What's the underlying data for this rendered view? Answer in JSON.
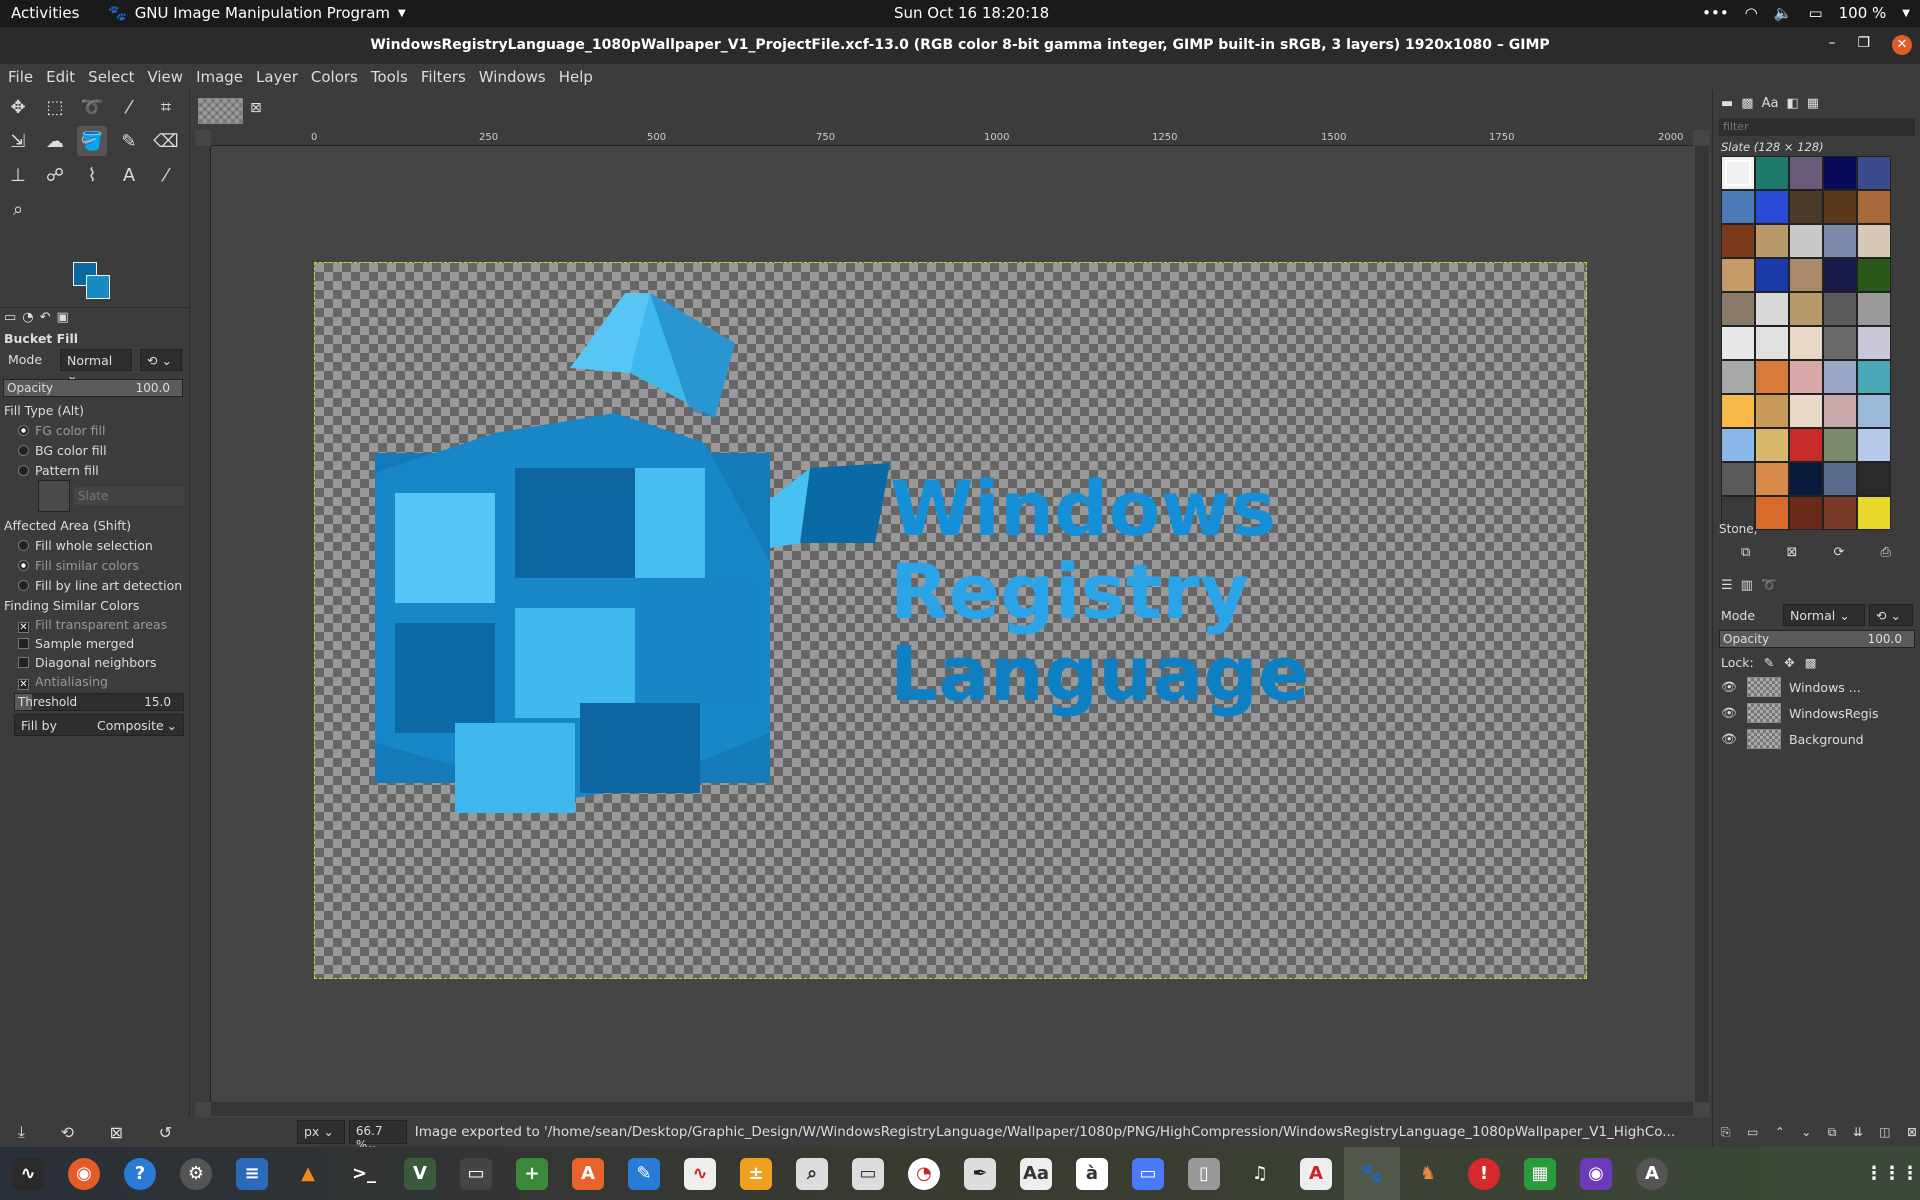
{
  "topbar": {
    "activities": "Activities",
    "app_name": "GNU Image Manipulation Program",
    "clock": "Sun Oct 16  18:20:18",
    "battery": "100 %"
  },
  "window": {
    "title": "WindowsRegistryLanguage_1080pWallpaper_V1_ProjectFile.xcf-13.0 (RGB color 8-bit gamma integer, GIMP built-in sRGB, 3 layers) 1920x1080 – GIMP"
  },
  "menu": [
    "File",
    "Edit",
    "Select",
    "View",
    "Image",
    "Layer",
    "Colors",
    "Tools",
    "Filters",
    "Windows",
    "Help"
  ],
  "tool_options": {
    "title": "Bucket Fill",
    "mode_label": "Mode",
    "mode_value": "Normal",
    "opacity_label": "Opacity",
    "opacity_value": "100.0",
    "fill_type_label": "Fill Type  (Alt)",
    "fill_types": [
      "FG color fill",
      "BG color fill",
      "Pattern fill"
    ],
    "pattern_name": "Slate",
    "affected_label": "Affected Area  (Shift)",
    "affected": [
      "Fill whole selection",
      "Fill similar colors",
      "Fill by line art detection"
    ],
    "finding_label": "Finding Similar Colors",
    "finding": [
      "Fill transparent areas",
      "Sample merged",
      "Diagonal neighbors",
      "Antialiasing"
    ],
    "threshold_label": "Threshold",
    "threshold_value": "15.0",
    "fillby_label": "Fill by",
    "fillby_value": "Composite"
  },
  "ruler": [
    "0",
    "250",
    "500",
    "750",
    "1000",
    "1250",
    "1500",
    "1750",
    "2000"
  ],
  "canvas_text": {
    "line1": "Windows",
    "line2": "Registry",
    "line3": "Language"
  },
  "status": {
    "unit": "px",
    "zoom": "66.7 %",
    "message": "Image exported to '/home/sean/Desktop/Graphic_Design/W/WindowsRegistryLanguage/Wallpaper/1080p/PNG/HighCompression/WindowsRegistryLanguage_1080pWallpaper_V1_HighCo..."
  },
  "patterns": {
    "filter_placeholder": "filter",
    "current": "Slate (128 × 128)",
    "selected_name": "Stone,",
    "colors": [
      "#f0f0f0",
      "#1e7a6a",
      "#6a5a7a",
      "#0a0a5a",
      "#3a4a8a",
      "#4a7ab8",
      "#2a4ad8",
      "#4a3a2a",
      "#5a3a1a",
      "#a86a3a",
      "#7a3a1a",
      "#b89a6a",
      "#c8c8c8",
      "#7a8aa8",
      "#d8c8b8",
      "#c89a6a",
      "#1a3aa8",
      "#a88a6a",
      "#1a1a4a",
      "#2a5a1a",
      "#8a7a6a",
      "#d8d8d8",
      "#b89a6a",
      "#5a5a5a",
      "#9a9a9a",
      "#e8e8e8",
      "#e0e0e0",
      "#e8d8c8",
      "#6a6a6a",
      "#c8c8d8",
      "#a8a8a8",
      "#d87a3a",
      "#d8a8a8",
      "#9aa8c8",
      "#4aa8b8",
      "#f8b84a",
      "#c89a5a",
      "#e8d8c8",
      "#c8a8a8",
      "#9ab8d8",
      "#8ab8e8",
      "#d8b86a",
      "#c82a2a",
      "#7a8a6a",
      "#b8c8e8",
      "#5a5a5a",
      "#d88a4a",
      "#0a1a3a",
      "#5a6a8a",
      "#2a2a2a",
      "#3a3a3a",
      "#d86a2a",
      "#6a2a1a",
      "#7a3a2a",
      "#e8d82a"
    ]
  },
  "layers": {
    "mode_label": "Mode",
    "mode_value": "Normal",
    "opacity_label": "Opacity",
    "opacity_value": "100.0",
    "lock_label": "Lock:",
    "items": [
      "Windows ...",
      "WindowsRegis",
      "Background"
    ]
  }
}
